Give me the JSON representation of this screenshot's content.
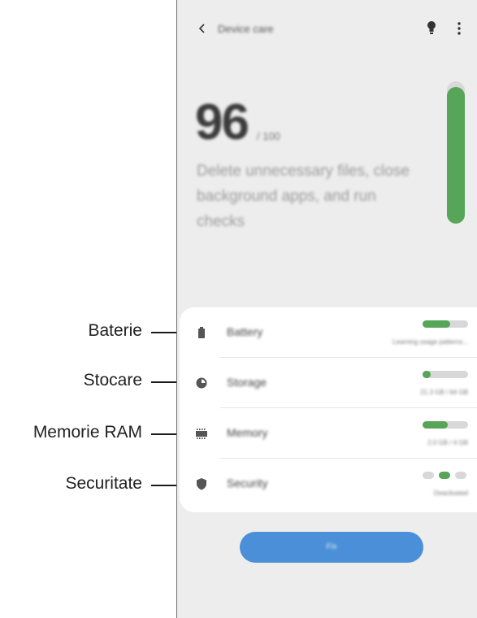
{
  "header": {
    "back_icon": "chevron-left-icon",
    "title": "Device care",
    "bulb_icon": "lightbulb-icon",
    "more_icon": "more-vertical-icon"
  },
  "score": {
    "value": "96",
    "total": "/ 100",
    "description": "Delete unnecessary files, close background apps, and run checks",
    "bar_fill": 0.96
  },
  "callouts": [
    "Baterie",
    "Stocare",
    "Memorie RAM",
    "Securitate"
  ],
  "items": [
    {
      "icon": "battery-icon",
      "label": "Battery",
      "subtext": "Learning usage patterns...",
      "progress": 0.6
    },
    {
      "icon": "storage-pie-icon",
      "label": "Storage",
      "subtext": "21.3 GB / 64 GB",
      "progress": 0.18
    },
    {
      "icon": "memory-chip-icon",
      "label": "Memory",
      "subtext": "2.0 GB / 4 GB",
      "progress": 0.55
    },
    {
      "icon": "shield-icon",
      "label": "Security",
      "subtext": "Deactivated",
      "status": "middle"
    }
  ],
  "action_button": {
    "label": "Fix"
  },
  "colors": {
    "accent_green": "#57a559",
    "button_blue": "#4a8fd8",
    "background": "#ededed"
  }
}
